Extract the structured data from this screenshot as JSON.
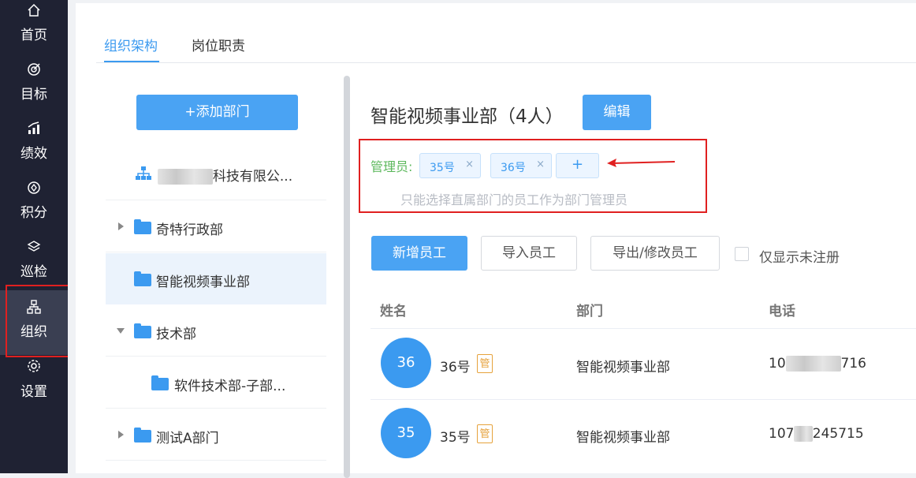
{
  "nav": {
    "items": [
      {
        "label": "首页",
        "icon": "home-icon"
      },
      {
        "label": "目标",
        "icon": "target-icon"
      },
      {
        "label": "绩效",
        "icon": "chart-icon"
      },
      {
        "label": "积分",
        "icon": "points-icon"
      },
      {
        "label": "巡检",
        "icon": "layers-icon"
      },
      {
        "label": "组织",
        "icon": "org-icon",
        "active": true
      },
      {
        "label": "设置",
        "icon": "gear-icon"
      }
    ]
  },
  "tabs": [
    {
      "label": "组织架构",
      "active": true
    },
    {
      "label": "岗位职责",
      "active": false
    }
  ],
  "tree": {
    "add_button": "+添加部门",
    "company": "科技有限公...",
    "nodes": [
      {
        "label": "奇特行政部",
        "expanded": false
      },
      {
        "label": "智能视频事业部",
        "selected": true
      },
      {
        "label": "技术部",
        "expanded": true
      },
      {
        "label": "软件技术部-子部..."
      },
      {
        "label": "测试A部门",
        "expanded": false
      }
    ]
  },
  "department": {
    "title": "智能视频事业部（4人）",
    "edit_button": "编辑",
    "admin_label": "管理员:",
    "admins": [
      "35号",
      "36号"
    ],
    "add_admin": "+",
    "hint": "只能选择直属部门的员工作为部门管理员"
  },
  "toolbar": {
    "add_employee": "新增员工",
    "import_employee": "导入员工",
    "export_employee": "导出/修改员工",
    "only_unregistered": "仅显示未注册"
  },
  "table": {
    "headers": [
      "姓名",
      "部门",
      "电话"
    ],
    "rows": [
      {
        "avatar": "36",
        "name": "36号",
        "badge": "管",
        "dept": "智能视频事业部",
        "phone_tail": "716",
        "phone_head": "10"
      },
      {
        "avatar": "35",
        "name": "35号",
        "badge": "管",
        "dept": "智能视频事业部",
        "phone_tail": "245715",
        "phone_head": "107"
      }
    ]
  },
  "colors": {
    "accent": "#3b9af0",
    "sidebar": "#1f2233",
    "annotation": "#e02020",
    "admin_label": "#5cb85c"
  }
}
